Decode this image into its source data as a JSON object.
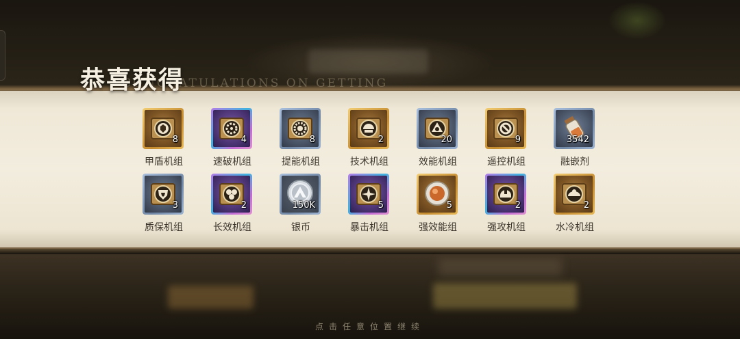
{
  "title": {
    "zh": "恭喜获得",
    "en": "CONGRATULATIONS ON GETTING"
  },
  "hint": "点击任意位置继续",
  "rewards": [
    {
      "name": "甲盾机组",
      "count": "8",
      "rarity": "gold",
      "icon": "shield-module-icon"
    },
    {
      "name": "速破机组",
      "count": "4",
      "rarity": "purple",
      "icon": "speed-break-module-icon"
    },
    {
      "name": "提能机组",
      "count": "8",
      "rarity": "blue",
      "icon": "energy-boost-module-icon"
    },
    {
      "name": "技术机组",
      "count": "2",
      "rarity": "gold",
      "icon": "tech-module-icon"
    },
    {
      "name": "效能机组",
      "count": "20",
      "rarity": "blue",
      "icon": "efficiency-module-icon"
    },
    {
      "name": "遥控机组",
      "count": "9",
      "rarity": "gold",
      "icon": "remote-module-icon"
    },
    {
      "name": "融嵌剂",
      "count": "3542",
      "rarity": "blue",
      "icon": "fusion-vial-icon"
    },
    {
      "name": "质保机组",
      "count": "3",
      "rarity": "blue",
      "icon": "warranty-module-icon"
    },
    {
      "name": "长效机组",
      "count": "2",
      "rarity": "purple",
      "icon": "longevity-module-icon"
    },
    {
      "name": "银币",
      "count": "150K",
      "rarity": "blue",
      "icon": "silver-coin-icon"
    },
    {
      "name": "暴击机组",
      "count": "5",
      "rarity": "purple",
      "icon": "critical-module-icon"
    },
    {
      "name": "强效能组",
      "count": "5",
      "rarity": "gold",
      "icon": "potent-energy-module-icon"
    },
    {
      "name": "强攻机组",
      "count": "2",
      "rarity": "purple",
      "icon": "assault-module-icon"
    },
    {
      "name": "水冷机组",
      "count": "2",
      "rarity": "gold",
      "icon": "water-cooling-module-icon"
    }
  ]
}
